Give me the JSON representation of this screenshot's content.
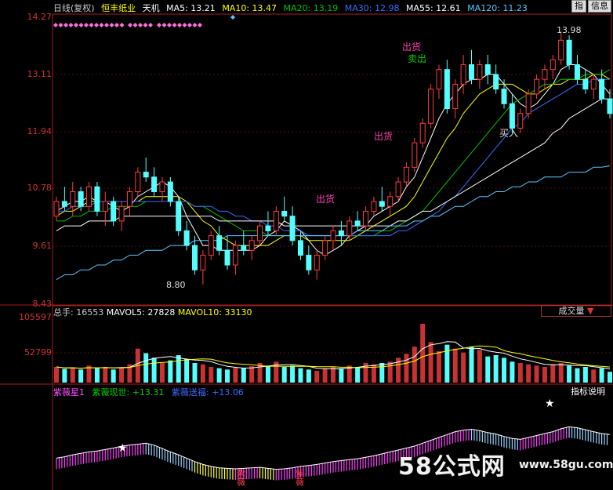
{
  "header": {
    "period": "日线(复权)",
    "stock_name": "恒丰纸业",
    "tool": "天机",
    "ma": [
      {
        "label": "MA5: 13.21",
        "color": "#ffffff"
      },
      {
        "label": "MA10: 13.47",
        "color": "#ffff00"
      },
      {
        "label": "MA20: 13.19",
        "color": "#00c000"
      },
      {
        "label": "MA30: 12.98",
        "color": "#3b6cff"
      },
      {
        "label": "MA55: 12.61",
        "color": "#ffffff"
      },
      {
        "label": "MA120: 11.23",
        "color": "#5bc8ff"
      }
    ]
  },
  "buttons": {
    "b1": "指",
    "b2": "信息"
  },
  "price_axis": {
    "ticks": [
      "14.27",
      "13.11",
      "11.94",
      "10.78",
      "9.61",
      "8.43"
    ]
  },
  "annotations": {
    "high_label": "13.98",
    "low_label": "8.80",
    "sell1": "出货",
    "sell2": "卖出",
    "sell3": "出货",
    "sell4": "出货",
    "buy": "买入"
  },
  "volume": {
    "header": [
      {
        "label": "总手: 16553",
        "color": "#cccccc"
      },
      {
        "label": "MAVOL5: 27828",
        "color": "#ffffff"
      },
      {
        "label": "MAVOL10: 33130",
        "color": "#ffff00"
      }
    ],
    "tab": "成交量",
    "ticks": [
      "105597",
      "52799"
    ]
  },
  "indicator": {
    "header": [
      {
        "label": "紫薇星1",
        "color": "#ff4fff"
      },
      {
        "label": "紫薇现世: +13.31",
        "color": "#00d000"
      },
      {
        "label": "紫薇送福: +13.06",
        "color": "#3b6cff"
      }
    ],
    "button": "指标说明",
    "marks": [
      "紫薇",
      "紫薇"
    ]
  },
  "watermark": {
    "brand": "58公式网",
    "url": "www.58gu.com"
  },
  "chart_data": {
    "type": "candlestick",
    "ylim": [
      8.43,
      14.27
    ],
    "candles": [
      [
        10.2,
        10.6,
        10.1,
        10.5
      ],
      [
        10.5,
        10.8,
        10.3,
        10.4
      ],
      [
        10.4,
        10.9,
        10.2,
        10.7
      ],
      [
        10.7,
        10.8,
        10.3,
        10.4
      ],
      [
        10.4,
        10.9,
        10.3,
        10.8
      ],
      [
        10.8,
        10.9,
        10.2,
        10.3
      ],
      [
        10.3,
        10.7,
        10.0,
        10.5
      ],
      [
        10.5,
        10.6,
        10.0,
        10.1
      ],
      [
        10.1,
        10.5,
        9.9,
        10.4
      ],
      [
        10.4,
        10.8,
        10.2,
        10.7
      ],
      [
        10.7,
        11.2,
        10.6,
        11.1
      ],
      [
        11.1,
        11.4,
        10.9,
        11.0
      ],
      [
        11.0,
        11.2,
        10.6,
        10.7
      ],
      [
        10.7,
        11.0,
        10.5,
        10.9
      ],
      [
        10.9,
        11.0,
        10.4,
        10.5
      ],
      [
        10.5,
        10.6,
        9.8,
        9.9
      ],
      [
        9.9,
        10.1,
        9.5,
        9.6
      ],
      [
        9.6,
        9.8,
        9.0,
        9.1
      ],
      [
        9.1,
        9.5,
        8.8,
        9.4
      ],
      [
        9.4,
        9.9,
        9.3,
        9.8
      ],
      [
        9.8,
        10.0,
        9.4,
        9.5
      ],
      [
        9.5,
        9.8,
        9.1,
        9.2
      ],
      [
        9.2,
        9.7,
        9.0,
        9.6
      ],
      [
        9.6,
        9.9,
        9.4,
        9.5
      ],
      [
        9.5,
        9.8,
        9.3,
        9.7
      ],
      [
        9.7,
        10.1,
        9.6,
        10.0
      ],
      [
        10.0,
        10.3,
        9.8,
        9.9
      ],
      [
        9.9,
        10.4,
        9.8,
        10.3
      ],
      [
        10.3,
        10.6,
        10.1,
        10.2
      ],
      [
        10.2,
        10.4,
        9.6,
        9.7
      ],
      [
        9.7,
        9.9,
        9.3,
        9.4
      ],
      [
        9.4,
        9.6,
        9.0,
        9.1
      ],
      [
        9.1,
        9.5,
        8.9,
        9.4
      ],
      [
        9.4,
        9.8,
        9.3,
        9.7
      ],
      [
        9.7,
        10.0,
        9.5,
        9.9
      ],
      [
        9.9,
        10.1,
        9.6,
        9.8
      ],
      [
        9.8,
        10.2,
        9.7,
        10.1
      ],
      [
        10.1,
        10.3,
        9.9,
        10.0
      ],
      [
        10.0,
        10.4,
        9.9,
        10.3
      ],
      [
        10.3,
        10.6,
        10.2,
        10.5
      ],
      [
        10.5,
        10.8,
        10.3,
        10.4
      ],
      [
        10.4,
        10.7,
        10.2,
        10.6
      ],
      [
        10.6,
        11.0,
        10.5,
        10.9
      ],
      [
        10.9,
        11.3,
        10.8,
        11.2
      ],
      [
        11.2,
        11.8,
        11.1,
        11.7
      ],
      [
        11.7,
        12.2,
        11.6,
        12.1
      ],
      [
        12.1,
        12.9,
        12.0,
        12.8
      ],
      [
        12.8,
        13.3,
        12.6,
        13.2
      ],
      [
        13.2,
        13.4,
        12.3,
        12.4
      ],
      [
        12.4,
        13.0,
        12.2,
        12.9
      ],
      [
        12.9,
        13.5,
        12.7,
        13.3
      ],
      [
        13.3,
        13.6,
        12.9,
        13.0
      ],
      [
        13.0,
        13.4,
        12.8,
        13.3
      ],
      [
        13.3,
        13.5,
        12.9,
        13.1
      ],
      [
        13.1,
        13.3,
        12.7,
        12.8
      ],
      [
        12.8,
        13.0,
        12.4,
        12.5
      ],
      [
        12.5,
        12.7,
        11.9,
        12.0
      ],
      [
        12.0,
        12.4,
        11.9,
        12.3
      ],
      [
        12.3,
        12.8,
        12.2,
        12.7
      ],
      [
        12.7,
        13.1,
        12.6,
        13.0
      ],
      [
        13.0,
        13.3,
        12.8,
        13.2
      ],
      [
        13.2,
        13.5,
        13.0,
        13.4
      ],
      [
        13.4,
        13.98,
        13.3,
        13.8
      ],
      [
        13.8,
        13.9,
        13.2,
        13.3
      ],
      [
        13.3,
        13.5,
        12.9,
        13.0
      ],
      [
        13.0,
        13.2,
        12.7,
        12.8
      ],
      [
        12.8,
        13.1,
        12.6,
        13.0
      ],
      [
        13.0,
        13.2,
        12.5,
        12.6
      ],
      [
        12.6,
        12.8,
        12.2,
        12.3
      ]
    ],
    "ma_series": [
      {
        "name": "MA5",
        "color": "#ffffff",
        "values": [
          10.3,
          10.4,
          10.5,
          10.5,
          10.6,
          10.5,
          10.5,
          10.4,
          10.3,
          10.4,
          10.6,
          10.7,
          10.8,
          10.9,
          10.8,
          10.6,
          10.2,
          9.9,
          9.6,
          9.6,
          9.5,
          9.5,
          9.5,
          9.5,
          9.5,
          9.6,
          9.8,
          9.9,
          10.1,
          10.0,
          9.9,
          9.7,
          9.5,
          9.4,
          9.5,
          9.6,
          9.8,
          9.9,
          10.0,
          10.2,
          10.3,
          10.4,
          10.5,
          10.8,
          11.0,
          11.4,
          11.8,
          12.2,
          12.5,
          12.7,
          12.9,
          13.0,
          13.0,
          13.1,
          13.1,
          12.9,
          12.7,
          12.5,
          12.4,
          12.5,
          12.7,
          12.9,
          13.2,
          13.3,
          13.3,
          13.2,
          13.1,
          12.9,
          12.7
        ]
      },
      {
        "name": "MA10",
        "color": "#ffff00",
        "values": [
          10.2,
          10.3,
          10.3,
          10.4,
          10.5,
          10.5,
          10.5,
          10.5,
          10.5,
          10.5,
          10.5,
          10.6,
          10.6,
          10.6,
          10.6,
          10.6,
          10.5,
          10.3,
          10.1,
          10.0,
          9.8,
          9.7,
          9.6,
          9.6,
          9.6,
          9.6,
          9.6,
          9.7,
          9.8,
          9.8,
          9.8,
          9.7,
          9.7,
          9.7,
          9.7,
          9.7,
          9.7,
          9.8,
          9.9,
          10.0,
          10.1,
          10.2,
          10.3,
          10.4,
          10.6,
          10.9,
          11.2,
          11.5,
          11.8,
          12.0,
          12.3,
          12.5,
          12.7,
          12.8,
          12.9,
          12.9,
          12.9,
          12.8,
          12.7,
          12.7,
          12.8,
          12.9,
          12.9,
          13.0,
          13.0,
          13.0,
          13.1,
          13.1,
          13.0
        ]
      },
      {
        "name": "MA20",
        "color": "#00c000",
        "values": [
          10.1,
          10.1,
          10.2,
          10.2,
          10.3,
          10.3,
          10.3,
          10.4,
          10.4,
          10.4,
          10.4,
          10.5,
          10.5,
          10.5,
          10.5,
          10.5,
          10.5,
          10.4,
          10.4,
          10.3,
          10.2,
          10.1,
          10.0,
          9.9,
          9.9,
          9.9,
          9.8,
          9.8,
          9.8,
          9.8,
          9.8,
          9.8,
          9.8,
          9.8,
          9.8,
          9.8,
          9.8,
          9.8,
          9.8,
          9.8,
          9.9,
          9.9,
          10.0,
          10.1,
          10.2,
          10.3,
          10.5,
          10.7,
          10.9,
          11.1,
          11.3,
          11.5,
          11.7,
          11.9,
          12.1,
          12.3,
          12.5,
          12.6,
          12.7,
          12.8,
          12.9,
          12.9,
          13.0,
          13.0,
          13.0,
          13.1,
          13.1,
          13.1,
          13.2
        ]
      },
      {
        "name": "MA30",
        "color": "#3b6cff",
        "values": [
          10.3,
          10.3,
          10.4,
          10.4,
          10.4,
          10.5,
          10.5,
          10.5,
          10.5,
          10.5,
          10.5,
          10.5,
          10.5,
          10.5,
          10.5,
          10.5,
          10.5,
          10.4,
          10.4,
          10.4,
          10.3,
          10.3,
          10.2,
          10.2,
          10.1,
          10.1,
          10.0,
          10.0,
          9.9,
          9.9,
          9.9,
          9.8,
          9.8,
          9.8,
          9.8,
          9.8,
          9.8,
          9.8,
          9.8,
          9.8,
          9.8,
          9.8,
          9.9,
          9.9,
          10.0,
          10.1,
          10.2,
          10.3,
          10.5,
          10.6,
          10.8,
          11.0,
          11.2,
          11.4,
          11.6,
          11.8,
          12.0,
          12.1,
          12.3,
          12.4,
          12.5,
          12.6,
          12.7,
          12.8,
          12.9,
          12.9,
          13.0,
          13.0,
          13.0
        ]
      },
      {
        "name": "MA55",
        "color": "#ffffff",
        "values": [
          9.9,
          10.0,
          10.0,
          10.0,
          10.1,
          10.1,
          10.1,
          10.1,
          10.2,
          10.2,
          10.2,
          10.2,
          10.2,
          10.2,
          10.2,
          10.2,
          10.2,
          10.2,
          10.2,
          10.2,
          10.1,
          10.1,
          10.1,
          10.1,
          10.1,
          10.1,
          10.1,
          10.1,
          10.0,
          10.0,
          10.0,
          10.0,
          10.0,
          10.0,
          10.0,
          10.0,
          10.0,
          10.0,
          10.0,
          10.0,
          10.0,
          10.0,
          10.1,
          10.1,
          10.2,
          10.3,
          10.3,
          10.4,
          10.5,
          10.6,
          10.7,
          10.8,
          10.9,
          11.0,
          11.1,
          11.2,
          11.3,
          11.4,
          11.5,
          11.6,
          11.7,
          11.9,
          12.0,
          12.2,
          12.3,
          12.4,
          12.5,
          12.6,
          12.6
        ]
      },
      {
        "name": "MA120",
        "color": "#5bc8ff",
        "values": [
          8.9,
          9.0,
          9.0,
          9.1,
          9.1,
          9.2,
          9.2,
          9.3,
          9.3,
          9.4,
          9.4,
          9.5,
          9.5,
          9.5,
          9.6,
          9.6,
          9.6,
          9.7,
          9.7,
          9.7,
          9.7,
          9.8,
          9.8,
          9.8,
          9.8,
          9.8,
          9.8,
          9.8,
          9.8,
          9.8,
          9.8,
          9.8,
          9.8,
          9.8,
          9.8,
          9.8,
          9.8,
          9.9,
          9.9,
          9.9,
          9.9,
          10.0,
          10.0,
          10.0,
          10.1,
          10.1,
          10.2,
          10.2,
          10.3,
          10.4,
          10.4,
          10.5,
          10.6,
          10.6,
          10.7,
          10.7,
          10.8,
          10.8,
          10.9,
          10.9,
          11.0,
          11.0,
          11.0,
          11.1,
          11.1,
          11.1,
          11.2,
          11.2,
          11.23
        ]
      }
    ],
    "volume_ylim": [
      0,
      105597
    ],
    "volume_values": [
      24000,
      21000,
      23000,
      20000,
      26000,
      22000,
      24000,
      20000,
      23000,
      28000,
      52000,
      45000,
      38000,
      30000,
      34000,
      42000,
      36000,
      30000,
      28000,
      24000,
      22000,
      20000,
      23000,
      22000,
      25000,
      30000,
      26000,
      32000,
      24000,
      26000,
      22000,
      20000,
      18000,
      21000,
      24000,
      22000,
      26000,
      24000,
      30000,
      28000,
      30000,
      32000,
      38000,
      44000,
      55000,
      90000,
      62000,
      48000,
      58000,
      52000,
      46000,
      55000,
      50000,
      40000,
      42000,
      38000,
      32000,
      30000,
      28000,
      26000,
      24000,
      28000,
      30000,
      26000,
      22000,
      24000,
      20000,
      22000,
      16553
    ],
    "indicator_values": [
      0.35,
      0.38,
      0.42,
      0.45,
      0.48,
      0.5,
      0.53,
      0.56,
      0.6,
      0.62,
      0.64,
      0.66,
      0.62,
      0.55,
      0.48,
      0.42,
      0.35,
      0.28,
      0.22,
      0.18,
      0.15,
      0.14,
      0.13,
      0.14,
      0.15,
      0.16,
      0.14,
      0.12,
      0.13,
      0.15,
      0.18,
      0.2,
      0.22,
      0.25,
      0.28,
      0.3,
      0.32,
      0.34,
      0.37,
      0.4,
      0.44,
      0.48,
      0.52,
      0.56,
      0.6,
      0.66,
      0.72,
      0.78,
      0.84,
      0.9,
      0.93,
      0.95,
      0.92,
      0.88,
      0.85,
      0.8,
      0.76,
      0.74,
      0.78,
      0.82,
      0.86,
      0.9,
      0.96,
      1.0,
      0.98,
      0.94,
      0.9,
      0.86,
      0.84
    ]
  }
}
